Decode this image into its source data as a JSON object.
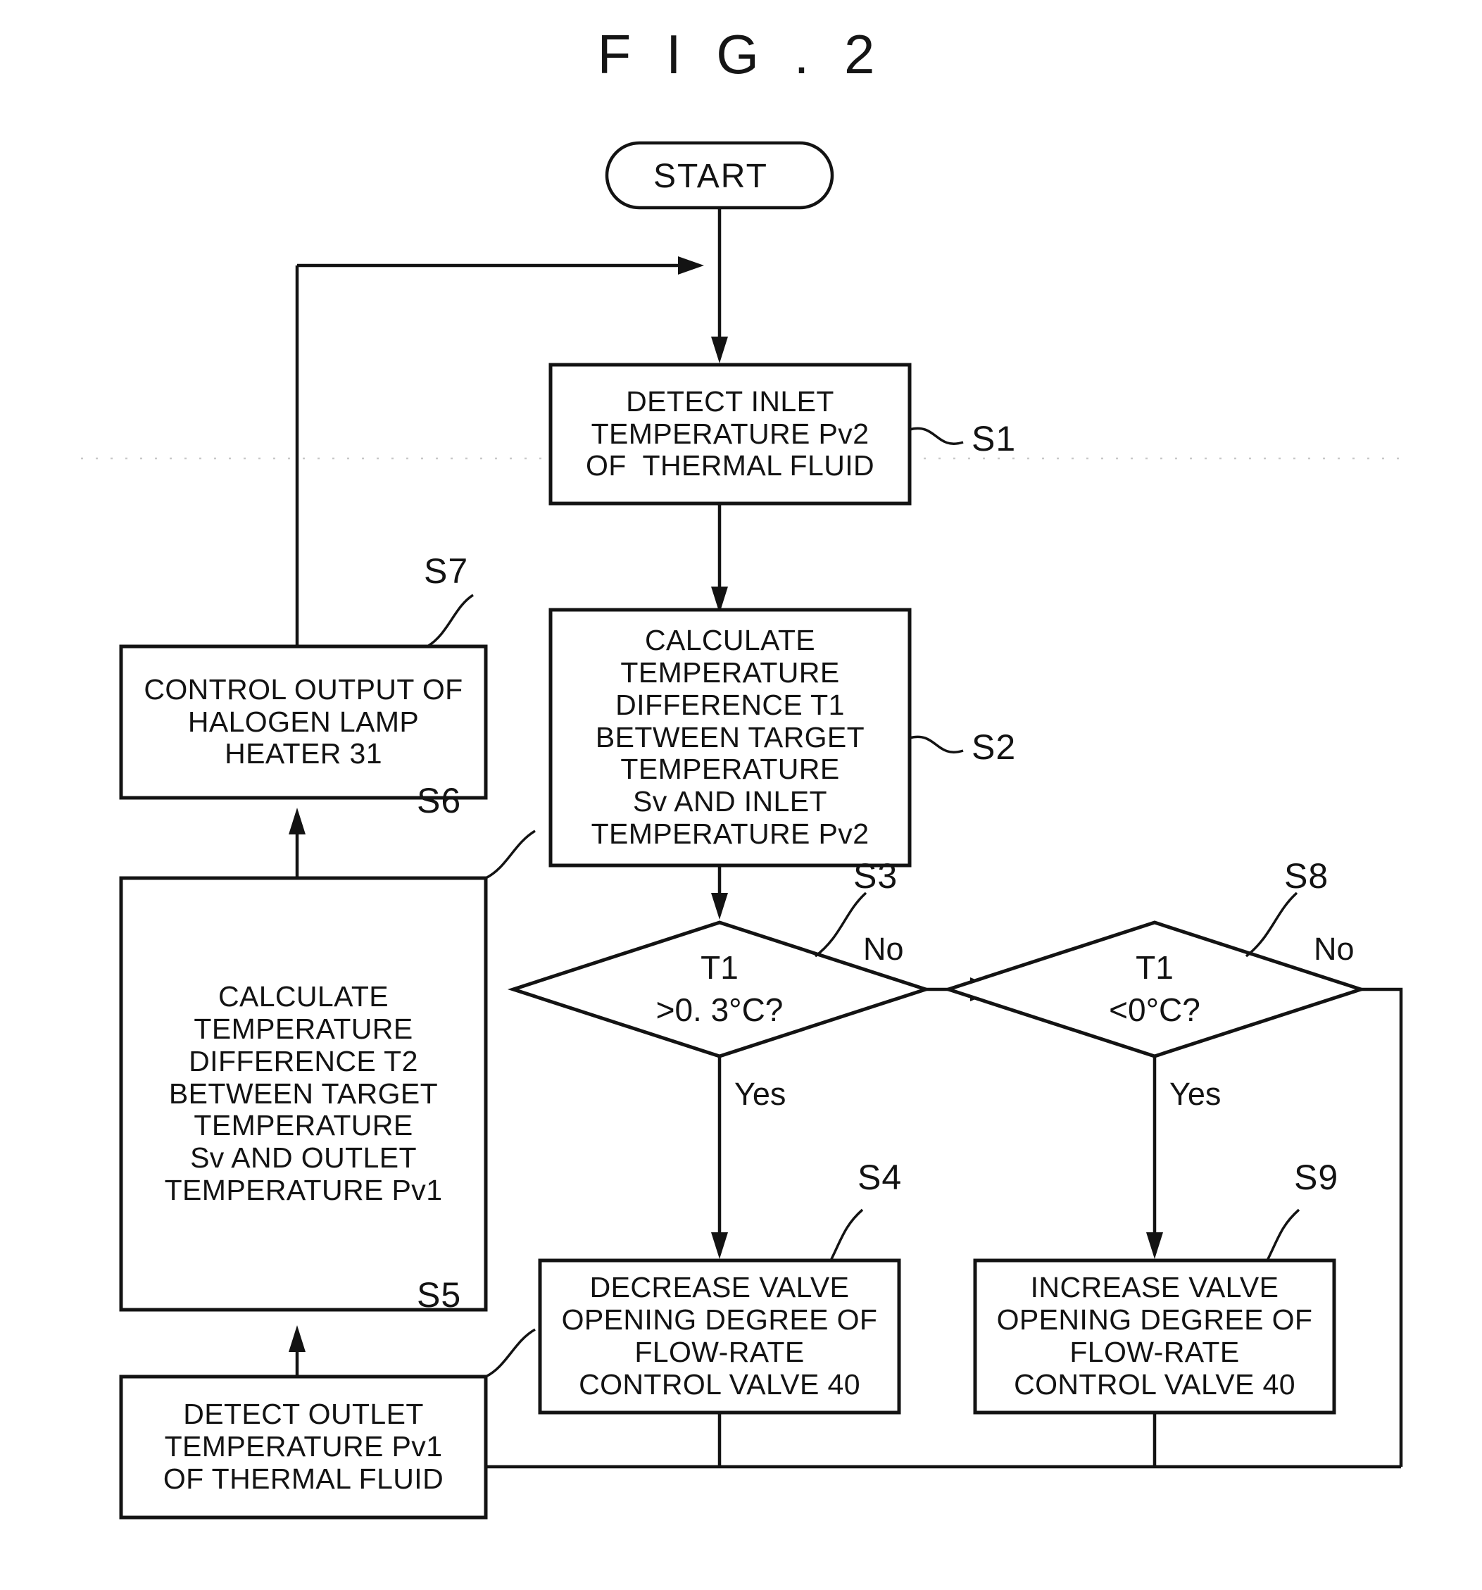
{
  "figure": {
    "title": "F I G . 2"
  },
  "nodes": {
    "start": {
      "label": "START"
    },
    "s1": {
      "tag": "S1",
      "lines": [
        "DETECT INLET",
        "TEMPERATURE Pv2",
        "OF  THERMAL FLUID"
      ]
    },
    "s2": {
      "tag": "S2",
      "lines": [
        "CALCULATE",
        "TEMPERATURE",
        "DIFFERENCE T1",
        "BETWEEN TARGET",
        "TEMPERATURE",
        "Sv AND INLET",
        "TEMPERATURE Pv2"
      ]
    },
    "s3": {
      "tag": "S3",
      "lines": [
        "T1",
        ">0. 3°C?"
      ]
    },
    "s4": {
      "tag": "S4",
      "lines": [
        "DECREASE VALVE",
        "OPENING DEGREE OF",
        "FLOW-RATE",
        "CONTROL VALVE 40"
      ]
    },
    "s5": {
      "tag": "S5",
      "lines": [
        "DETECT OUTLET",
        "TEMPERATURE Pv1",
        "OF THERMAL FLUID"
      ]
    },
    "s6": {
      "tag": "S6",
      "lines": [
        "CALCULATE",
        "TEMPERATURE",
        "DIFFERENCE T2",
        "BETWEEN TARGET",
        "TEMPERATURE",
        "Sv AND OUTLET",
        "TEMPERATURE Pv1"
      ]
    },
    "s7": {
      "tag": "S7",
      "lines": [
        "CONTROL OUTPUT OF",
        "HALOGEN LAMP",
        "HEATER 31"
      ]
    },
    "s8": {
      "tag": "S8",
      "lines": [
        "T1",
        "<0°C?"
      ]
    },
    "s9": {
      "tag": "S9",
      "lines": [
        "INCREASE VALVE",
        "OPENING DEGREE OF",
        "FLOW-RATE",
        "CONTROL VALVE 40"
      ]
    }
  },
  "edge_labels": {
    "s3_no": "No",
    "s3_yes": "Yes",
    "s8_no": "No",
    "s8_yes": "Yes"
  },
  "colors": {
    "ink": "#131313",
    "paper": "#ffffff",
    "artifact": "#c8c8c8"
  }
}
